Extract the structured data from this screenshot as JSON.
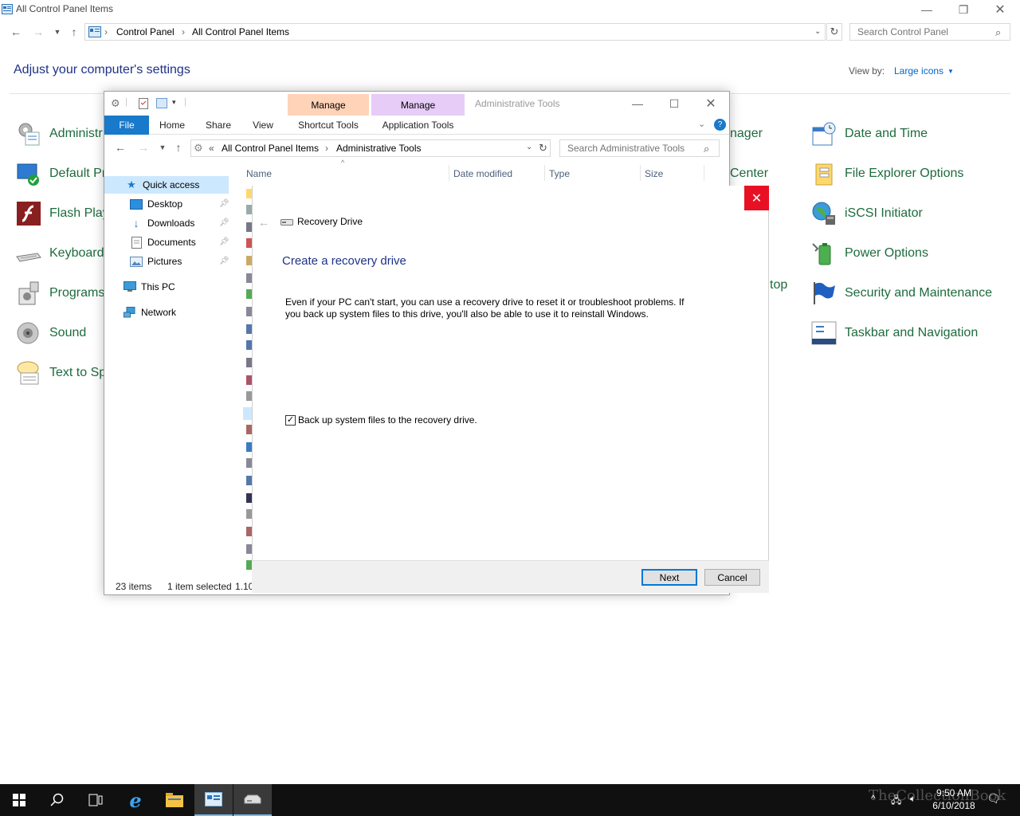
{
  "control_panel": {
    "title": "All Control Panel Items",
    "breadcrumb": [
      "Control Panel",
      "All Control Panel Items"
    ],
    "search_placeholder": "Search Control Panel",
    "heading": "Adjust your computer's settings",
    "view_by_label": "View by:",
    "view_by_value": "Large icons",
    "left_items": [
      "Administr",
      "Default Pr",
      "Flash Play",
      "Keyboard",
      "Programs",
      "Sound",
      "Text to Spe"
    ],
    "mid_items": [
      "nager",
      "Center",
      "top"
    ],
    "right_items": [
      "Date and Time",
      "File Explorer Options",
      "iSCSI Initiator",
      "Power Options",
      "Security and Maintenance",
      "Taskbar and Navigation"
    ]
  },
  "explorer": {
    "title": "Administrative Tools",
    "manage_tab_1": "Manage",
    "manage_tab_2": "Manage",
    "tabs": [
      "File",
      "Home",
      "Share",
      "View"
    ],
    "shortcut_tools": "Shortcut Tools",
    "application_tools": "Application Tools",
    "address": {
      "prefix": "«",
      "parent": "All Control Panel Items",
      "current": "Administrative Tools"
    },
    "search_placeholder": "Search Administrative Tools",
    "nav": {
      "quick_access": "Quick access",
      "desktop": "Desktop",
      "downloads": "Downloads",
      "documents": "Documents",
      "pictures": "Pictures",
      "this_pc": "This PC",
      "network": "Network"
    },
    "columns": [
      "Name",
      "Date modified",
      "Type",
      "Size"
    ],
    "status": {
      "count": "23 items",
      "selected": "1 item selected",
      "size": "1.10"
    }
  },
  "recovery_dialog": {
    "app_title": "Recovery Drive",
    "heading": "Create a recovery drive",
    "description": "Even if your PC can't start, you can use a recovery drive to reset it or troubleshoot problems. If you back up system files to this drive, you'll also be able to use it to reinstall Windows.",
    "checkbox_label": "Back up system files to the recovery drive.",
    "checkbox_checked": true,
    "next": "Next",
    "cancel": "Cancel"
  },
  "taskbar": {
    "time": "9:50 AM",
    "date": "6/10/2018",
    "watermark": "TheCollectionBook"
  },
  "colors": {
    "link_green": "#1d6b3d",
    "heading_blue": "#1e3287",
    "manage_orange": "#ffd3b8",
    "manage_purple": "#e6ccf7",
    "file_tab_blue": "#1979ca",
    "close_red": "#e81123"
  }
}
